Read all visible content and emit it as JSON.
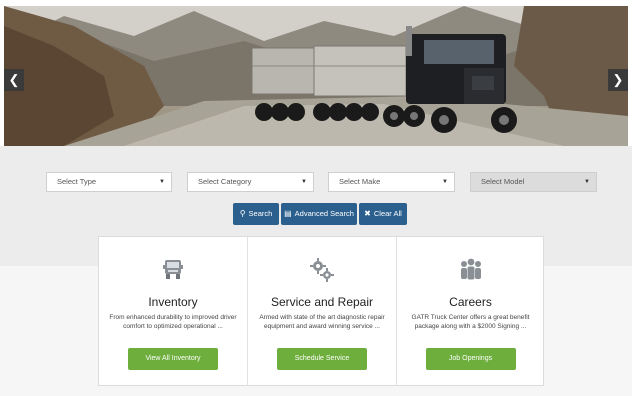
{
  "hero": {
    "prev_arrow": "❮",
    "next_arrow": "❯"
  },
  "search": {
    "type_label": "Select Type",
    "category_label": "Select Category",
    "make_label": "Select Make",
    "model_label": "Select Model",
    "caret": "▼",
    "search_label": "Search",
    "advanced_label": "Advanced Search",
    "clear_label": "Clear All"
  },
  "cards": [
    {
      "icon": "truck-icon",
      "title": "Inventory",
      "description": "From enhanced durability to improved driver comfort to optimized operational ...",
      "button": "View All Inventory"
    },
    {
      "icon": "gears-icon",
      "title": "Service and Repair",
      "description": "Armed with state of the art diagnostic repair equipment and award winning service ...",
      "button": "Schedule Service"
    },
    {
      "icon": "people-icon",
      "title": "Careers",
      "description": "GATR Truck Center offers a great benefit package along with a $2000 Signing ...",
      "button": "Job Openings"
    }
  ],
  "colors": {
    "primary_blue": "#2b5f8e",
    "action_green": "#6dae3c",
    "panel_gray": "#ececec"
  }
}
